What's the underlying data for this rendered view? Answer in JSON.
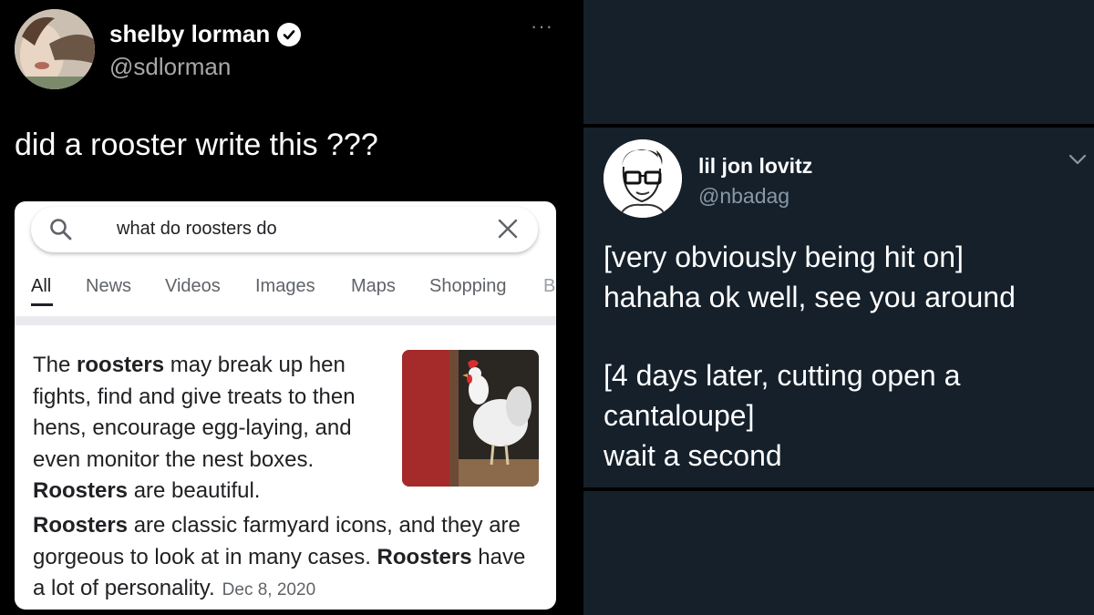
{
  "left_tweet": {
    "display_name": "shelby lorman",
    "handle": "@sdlorman",
    "more_label": "···",
    "text": "did a rooster write this ???",
    "google": {
      "query": "what do roosters do",
      "tabs": [
        "All",
        "News",
        "Videos",
        "Images",
        "Maps",
        "Shopping",
        "B"
      ],
      "active_tab": "All",
      "snippet": {
        "w1": "The ",
        "b1": "roosters",
        "w2": " may break up hen fights, find and give treats to then hens, encourage egg-laying, and even monitor the nest boxes. ",
        "b2": "Roosters",
        "w3": " are beautiful.",
        "b3": "Roosters",
        "w4": " are classic farmyard icons, and they are gorgeous to look at in many cases. ",
        "b4": "Roosters",
        "w5": " have a lot of personality.",
        "date": "Dec 8, 2020"
      }
    }
  },
  "right_tweet": {
    "display_name": "lil jon lovitz",
    "handle": "@nbadag",
    "lines_a": [
      "[very obviously being hit on]",
      "hahaha ok well, see you around"
    ],
    "lines_b": [
      "[4 days later, cutting open a",
      "cantaloupe]",
      "wait a second"
    ]
  },
  "colors": {
    "twitter_dark": "#15202b",
    "black": "#000000",
    "google_text": "#202124",
    "google_muted": "#5f6368"
  },
  "icons": [
    "verified-badge-icon",
    "search-icon",
    "close-icon",
    "more-icon",
    "chevron-down-icon"
  ]
}
